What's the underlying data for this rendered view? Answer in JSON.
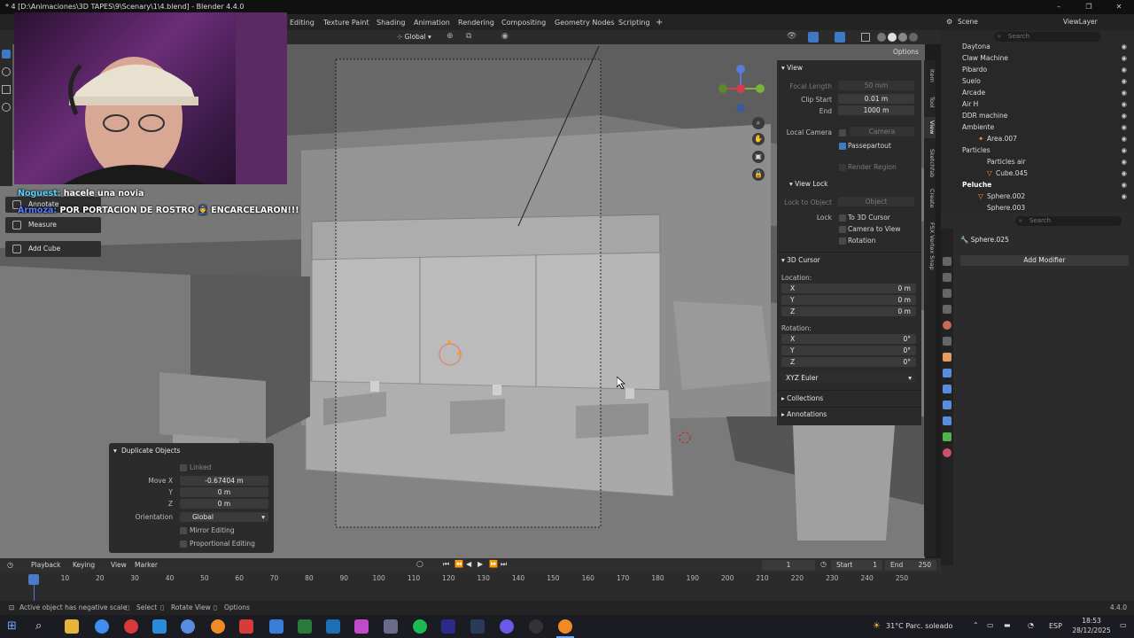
{
  "window": {
    "title": "* 4 [D:\\Animaciones\\3D TAPES\\9\\Scenary\\1\\4.blend] - Blender 4.4.0",
    "minimize": "–",
    "maximize": "❐",
    "close": "✕"
  },
  "workspace_tabs": [
    "Editing",
    "Texture Paint",
    "Shading",
    "Animation",
    "Rendering",
    "Compositing",
    "Geometry Nodes",
    "Scripting",
    "+"
  ],
  "header_3d": {
    "orientation": "Global",
    "options_label": "Options"
  },
  "toolbar": {
    "annotate": "Annotate",
    "measure": "Measure",
    "add_cube": "Add Cube"
  },
  "chat": [
    {
      "user": "Noguest:",
      "message": "hacele una novia",
      "color": "#5ad0ff"
    },
    {
      "user": "Armoza:",
      "message": "POR PORTACION DE ROSTRO 👮 ENCARCELARON!!!",
      "color": "#5a7cff"
    }
  ],
  "npanel": {
    "view_header": "View",
    "focal_length_label": "Focal Length",
    "focal_length_value": "50 mm",
    "clip_start_label": "Clip Start",
    "clip_start_value": "0.01 m",
    "end_label": "End",
    "end_value": "1000 m",
    "local_camera_label": "Local Camera",
    "camera_placeholder": "Camera",
    "passepartout_label": "Passepartout",
    "render_region_label": "Render Region",
    "view_lock_header": "View Lock",
    "lock_to_object_label": "Lock to Object",
    "object_placeholder": "Object",
    "lock_label": "Lock",
    "to_3d_cursor_label": "To 3D Cursor",
    "camera_to_view_label": "Camera to View",
    "rotation_lock_label": "Rotation",
    "cursor_header": "3D Cursor",
    "location_label": "Location:",
    "loc_x_label": "X",
    "loc_x": "0 m",
    "loc_y_label": "Y",
    "loc_y": "0 m",
    "loc_z_label": "Z",
    "loc_z": "0 m",
    "rotation_label": "Rotation:",
    "rot_x_label": "X",
    "rot_x": "0°",
    "rot_y_label": "Y",
    "rot_y": "0°",
    "rot_z_label": "Z",
    "rot_z": "0°",
    "euler_mode": "XYZ Euler",
    "collections_header": "Collections",
    "annotations_header": "Annotations"
  },
  "side_tabs": [
    "Item",
    "Tool",
    "View",
    "Sketchfab",
    "Create",
    "FSX Vertex Snap"
  ],
  "outliner": {
    "scene": "Scene",
    "view_layer": "ViewLayer",
    "search_placeholder": "Search",
    "rows": [
      {
        "label": "Daytona",
        "indent": 0,
        "bold": false
      },
      {
        "label": "Claw Machine",
        "indent": 0,
        "bold": false
      },
      {
        "label": "Pibardo",
        "indent": 0,
        "bold": false
      },
      {
        "label": "Suelo",
        "indent": 0,
        "bold": false
      },
      {
        "label": "Arcade",
        "indent": 0,
        "bold": false
      },
      {
        "label": "Air H",
        "indent": 0,
        "bold": false
      },
      {
        "label": "DDR machine",
        "indent": 0,
        "bold": false
      },
      {
        "label": "Ambiente",
        "indent": 0,
        "bold": false
      },
      {
        "label": "Area.007",
        "indent": 1,
        "bold": false
      },
      {
        "label": "Particles",
        "indent": 0,
        "bold": false
      },
      {
        "label": "Particles air",
        "indent": 1,
        "bold": false
      },
      {
        "label": "Cube.045",
        "indent": 2,
        "bold": false
      },
      {
        "label": "Peluche",
        "indent": 0,
        "bold": true
      },
      {
        "label": "Sphere.002",
        "indent": 1,
        "bold": false
      },
      {
        "label": "Sphere.003",
        "indent": 1,
        "bold": false
      }
    ]
  },
  "properties": {
    "search_placeholder": "Search",
    "object_name": "Sphere.025",
    "add_modifier": "Add Modifier"
  },
  "duplicate_panel": {
    "title": "Duplicate Objects",
    "linked": "Linked",
    "move_x_label": "Move X",
    "move_x": "-0.67404 m",
    "y_label": "Y",
    "y": "0 m",
    "z_label": "Z",
    "z": "0 m",
    "orientation_label": "Orientation",
    "orientation": "Global",
    "mirror_editing": "Mirror Editing",
    "proportional_editing": "Proportional Editing"
  },
  "timeline": {
    "playback": "Playback",
    "keying": "Keying",
    "view": "View",
    "marker": "Marker",
    "current_frame": "1",
    "start_label": "Start",
    "start": "1",
    "end_label": "End",
    "end": "250",
    "ticks": [
      "1",
      "10",
      "20",
      "30",
      "40",
      "50",
      "60",
      "70",
      "80",
      "90",
      "100",
      "110",
      "120",
      "130",
      "140",
      "150",
      "160",
      "170",
      "180",
      "190",
      "200",
      "210",
      "220",
      "230",
      "240",
      "250"
    ]
  },
  "statusbar": {
    "message": "Active object has negative scale",
    "select": "Select",
    "rotate_view": "Rotate View",
    "options": "Options",
    "version": "4.4.0"
  },
  "taskbar": {
    "weather": "31°C  Parc. soleado",
    "lang": "ESP",
    "time": "18:53",
    "date": "28/12/2025"
  }
}
